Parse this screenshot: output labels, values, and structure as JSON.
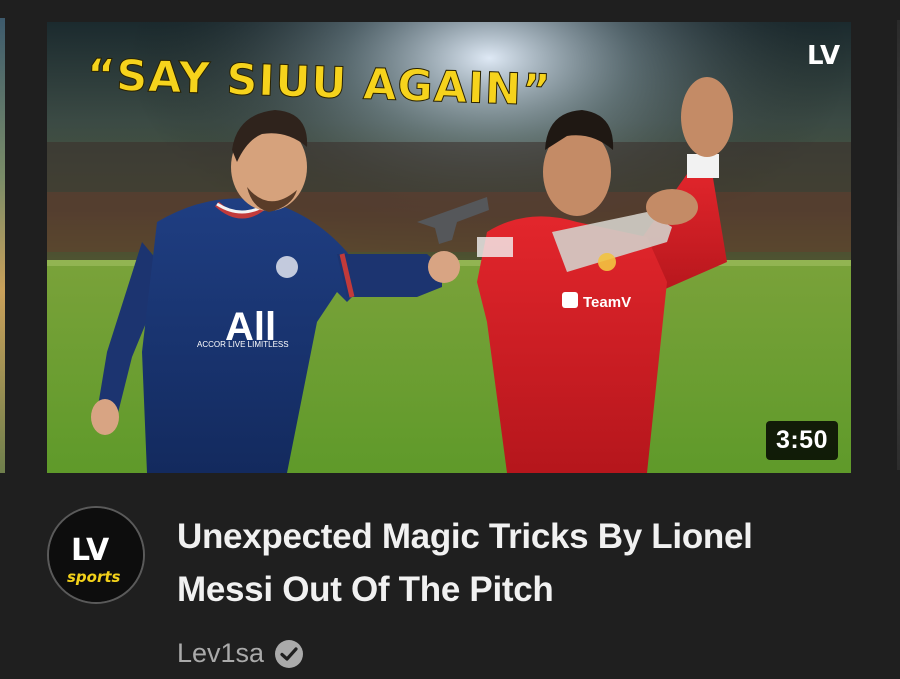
{
  "video": {
    "thumbnail": {
      "overlay_quote": "“SAY SIUU AGAIN”",
      "corner_logo": "LV",
      "jersey_left_sponsor": "All",
      "jersey_left_sponsor_sub": "ACCOR LIVE LIMITLESS",
      "jersey_right_sponsor": "TeamV"
    },
    "duration": "3:50",
    "title_line1": "Unexpected Magic Tricks By Lionel",
    "title_line2": "Messi Out Of The Pitch",
    "channel_name": "Lev1sa",
    "channel_verified_icon": "verified-check-icon",
    "avatar": {
      "monogram": "LV",
      "sub": "sports"
    }
  },
  "colors": {
    "background": "#1f1f1f",
    "title_text": "#f1f1f1",
    "meta_text": "#aaaaaa",
    "overlay_quote": "#f6d31c"
  }
}
